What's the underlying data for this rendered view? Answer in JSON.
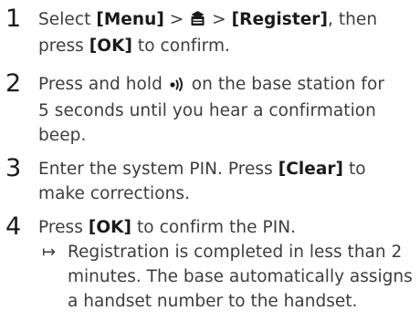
{
  "steps": [
    {
      "number": "1",
      "line1_pre": "Select ",
      "line1_menu": "[Menu]",
      "line1_sep1": " > ",
      "line1_icon": "menu-book-icon",
      "line1_sep2": " > ",
      "line1_register": "[Register]",
      "line1_post": ", then",
      "line2_pre": "press ",
      "line2_ok": "[OK]",
      "line2_post": " to confirm."
    },
    {
      "number": "2",
      "line1_pre": "Press and hold ",
      "line1_icon": "page-icon",
      "line1_post": " on the base station for",
      "line2": "5 seconds until you hear a confirmation",
      "line3": "beep."
    },
    {
      "number": "3",
      "line1_pre": "Enter the system PIN. Press ",
      "line1_clear": "[Clear]",
      "line1_post": " to",
      "line2": "make corrections."
    },
    {
      "number": "4",
      "line1_pre": "Press ",
      "line1_ok": "[OK]",
      "line1_post": " to confirm the PIN.",
      "result_arrow": "↦",
      "result_lines": [
        "Registration is completed in less than 2",
        "minutes. The base automatically assigns",
        "a handset number to the handset."
      ]
    }
  ]
}
